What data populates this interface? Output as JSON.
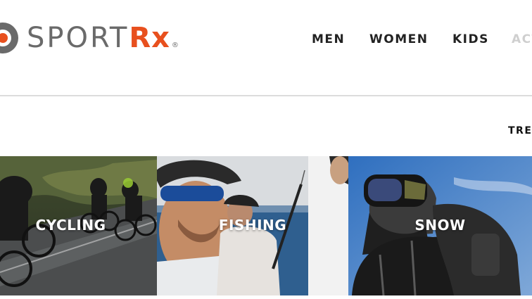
{
  "brand": {
    "name_part1": "SPORT",
    "name_part2": "Rx",
    "registered": "®",
    "colors": {
      "gray": "#6a6a6a",
      "orange": "#e8501e"
    }
  },
  "nav": {
    "items": [
      {
        "label": "MEN"
      },
      {
        "label": "WOMEN"
      },
      {
        "label": "KIDS"
      },
      {
        "label": "ACT"
      }
    ]
  },
  "section": {
    "trending_label": "TRE"
  },
  "tiles": [
    {
      "label": "CYCLING"
    },
    {
      "label": "FISHING"
    },
    {
      "label": "SNOW"
    }
  ]
}
